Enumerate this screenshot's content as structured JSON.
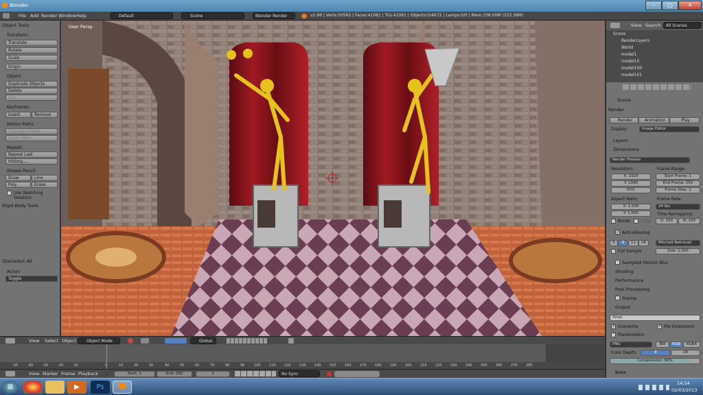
{
  "window": {
    "title": "Blender"
  },
  "menubar": {
    "menus": [
      "File",
      "Add",
      "Render",
      "Window",
      "Help"
    ],
    "layout": "Default",
    "scene": "Scene",
    "engine": "Blender Render",
    "stats": "v2.66 | Verts:50565 | Faces:41081 | Tris:41081 | Objects:0/4672 | Lamps:0/0 | Mem:338.00M (253.38M)"
  },
  "tools": {
    "title": "Object Tools",
    "transform_label": "Transform:",
    "translate": "Translate",
    "rotate": "Rotate",
    "scale": "Scale",
    "origin": "Origin",
    "object_label": "Object:",
    "duplicate": "Duplicate Objects",
    "delete": "Delete",
    "join": "Join",
    "keyframes_label": "Keyframes:",
    "insert": "Insert",
    "remove": "Remove",
    "motion_label": "Motion Paths:",
    "calculate": "Calculate Paths",
    "clear": "Clear Paths",
    "repeat_label": "Repeat:",
    "repeat_last": "Repeat Last",
    "history": "History...",
    "grease_label": "Grease Pencil:",
    "draw": "Draw",
    "line": "Line",
    "poly": "Poly",
    "erase": "Erase",
    "sketching": "Use Sketching Sessions",
    "rigid": "Rigid Body Tools",
    "deselect": "(De)select All",
    "action_label": "Action",
    "action_value": "Toggle"
  },
  "viewport": {
    "label": "User Persp"
  },
  "view_header": {
    "view": "View",
    "select": "Select",
    "object": "Object",
    "mode": "Object Mode",
    "orientation": "Global"
  },
  "timeline": {
    "ticks": [
      "-50",
      "-40",
      "-30",
      "-20",
      "-10",
      "0",
      "10",
      "20",
      "30",
      "40",
      "50",
      "60",
      "70",
      "80",
      "90",
      "100",
      "110",
      "120",
      "130",
      "140",
      "150",
      "160",
      "170",
      "180",
      "190",
      "200",
      "210",
      "220",
      "230",
      "240",
      "250",
      "260",
      "270",
      "280"
    ],
    "view": "View",
    "marker": "Marker",
    "frame": "Frame",
    "playback": "Playback",
    "start": "Start: 1",
    "end": "End: 250",
    "current": "1",
    "sync": "No Sync"
  },
  "outliner": {
    "view": "View",
    "search": "Search",
    "filter": "All Scenes",
    "items": [
      "Scene",
      "RenderLayers",
      "World",
      "model1",
      "model10",
      "model100",
      "model101"
    ]
  },
  "props": {
    "scene": "Scene",
    "render_header": "Render",
    "render": "Render",
    "animation": "Animation",
    "play": "Play",
    "display_label": "Display:",
    "display_value": "Image Editor",
    "layers": "Layers",
    "dimensions": "Dimensions",
    "presets": "Render Presets",
    "resolution": "Resolution:",
    "frame_range": "Frame Range:",
    "res_x": "X: 1920",
    "res_y": "Y: 1080",
    "res_pct": "50%",
    "start_frame": "Start Frame: 1",
    "end_frame": "End Frame: 250",
    "frame_step": "Frame Step: 1",
    "aspect": "Aspect Ratio:",
    "frame_rate": "Frame Rate:",
    "asp_x": "X: 1.000",
    "asp_y": "Y: 1.000",
    "fps": "24 fps",
    "time_remap": "Time Remapping:",
    "tr_old": "O: 100",
    "tr_new": "N: 100",
    "border": "Borde",
    "crop": "Crop",
    "aa": "Anti-Aliasing",
    "aa_samples": [
      "5",
      "8",
      "11",
      "16"
    ],
    "aa_filter": "Mitchell-Netravali",
    "full_sample": "Full Sample",
    "size": "Size: 1.000",
    "motion_blur": "Sampled Motion Blur",
    "shading": "Shading",
    "performance": "Performance",
    "post": "Post Processing",
    "stamp": "Stamp",
    "output": "Output",
    "path": "/tmp\\",
    "overwrite": "Overwrite",
    "file_ext": "File Extensions",
    "placeholders": "Placeholders",
    "format": "PNG",
    "bw": "BW",
    "rgb": "RGB",
    "rgba": "RGBA",
    "color_depth": "Color Depth:",
    "depth8": "8",
    "depth16": "16",
    "compression": "Compression: 90%",
    "bake": "Bake"
  },
  "taskbar": {
    "time": "14:54",
    "date": "02/03/2013"
  }
}
